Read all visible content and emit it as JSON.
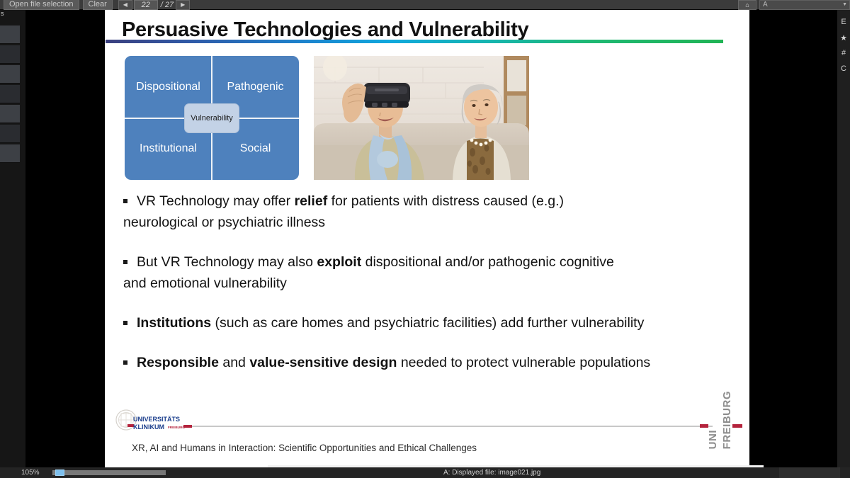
{
  "toolbar": {
    "open_file_label": "Open file selection",
    "clear_label": "Clear",
    "prev_icon": "◀",
    "next_icon": "▶",
    "current_page": "22",
    "total_pages": "/ 27",
    "home_icon": "⌂",
    "field_value": "A",
    "field_caret": "▼"
  },
  "left_rail": {
    "label": "s"
  },
  "right_rail": {
    "icons": [
      "E",
      "★",
      "#",
      "C"
    ]
  },
  "slide": {
    "title": "Persuasive Technologies and Vulnerability",
    "matrix": {
      "top_left": "Dispositional",
      "top_right": "Pathogenic",
      "bottom_left": "Institutional",
      "bottom_right": "Social",
      "center": "Vulnerability",
      "fill_color": "#4e81bd",
      "center_fill_color": "#c3d2e6"
    },
    "photo": {
      "alt": "Elderly man wearing a VR headset seated beside a smiling elderly woman on a sofa"
    },
    "bullets": [
      {
        "marker": "▪",
        "line1_pre": "VR Technology may offer ",
        "line1_bold": "relief",
        "line1_post": " for patients with distress caused (e.g.)",
        "line2": "neurological or psychiatric illness"
      },
      {
        "marker": "▪",
        "line1_pre": "But VR Technology may also ",
        "line1_bold": "exploit",
        "line1_post": " dispositional and/or pathogenic cognitive",
        "line2": "and emotional vulnerability"
      },
      {
        "marker": "▪",
        "line1_pre": "",
        "line1_bold": "Institutions",
        "line1_post": " (such as care homes and psychiatric facilities) add further vulnerability",
        "line2": ""
      },
      {
        "marker": "▪",
        "line1_pre": "",
        "line1_bold": "Responsible",
        "line1_mid": " and ",
        "line1_bold2": "value-sensitive design",
        "line1_post": " needed to protect vulnerable populations",
        "line2": ""
      }
    ],
    "footer": {
      "text": "XR, AI and Humans in Interaction: Scientific Opportunities and Ethical Challenges",
      "klinikum_line1": "UNIVERSITÄTS",
      "klinikum_line2": "KLINIKUM",
      "klinikum_city": "FREIBURG",
      "uni_word_1": "UNI",
      "uni_word_2": "FREIBURG",
      "accent_red": "#b4233c",
      "accent_blue": "#1b3e8c"
    }
  },
  "statusbar": {
    "zoom_level": "105%",
    "message": "A: Displayed file: image021.jpg"
  }
}
